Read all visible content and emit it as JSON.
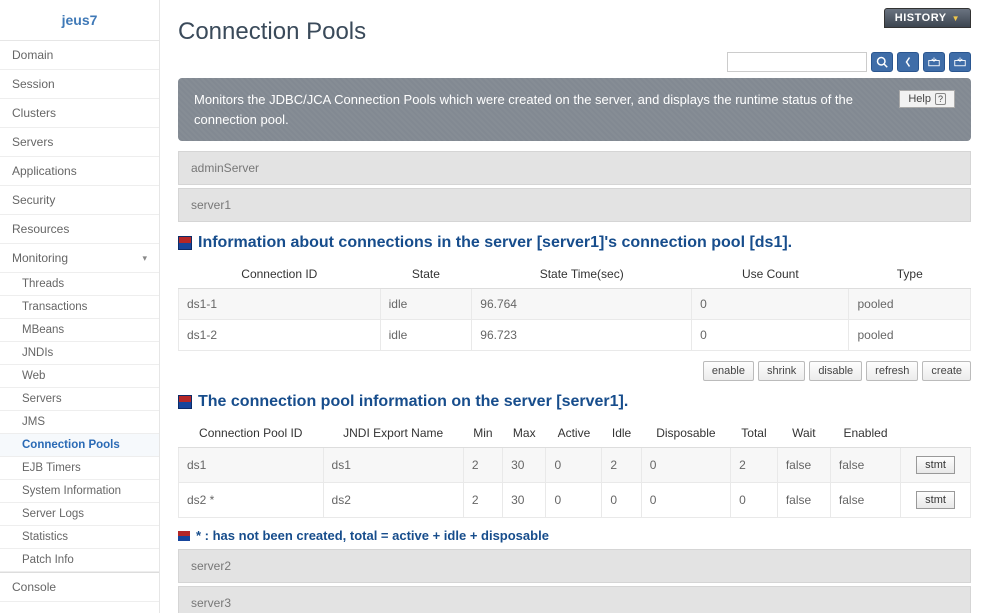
{
  "sidebar": {
    "title": "jeus7",
    "items": [
      {
        "label": "Domain"
      },
      {
        "label": "Session"
      },
      {
        "label": "Clusters"
      },
      {
        "label": "Servers"
      },
      {
        "label": "Applications"
      },
      {
        "label": "Security"
      },
      {
        "label": "Resources"
      },
      {
        "label": "Monitoring",
        "expandable": true
      }
    ],
    "sub": [
      {
        "label": "Threads"
      },
      {
        "label": "Transactions"
      },
      {
        "label": "MBeans"
      },
      {
        "label": "JNDIs"
      },
      {
        "label": "Web"
      },
      {
        "label": "Servers"
      },
      {
        "label": "JMS"
      },
      {
        "label": "Connection Pools",
        "active": true
      },
      {
        "label": "EJB Timers"
      },
      {
        "label": "System Information"
      },
      {
        "label": "Server Logs"
      },
      {
        "label": "Statistics"
      },
      {
        "label": "Patch Info"
      }
    ],
    "console": "Console"
  },
  "header": {
    "history": "HISTORY",
    "title": "Connection Pools",
    "search_placeholder": "",
    "desc": "Monitors the JDBC/JCA Connection Pools which were created on the server, and displays the runtime status of the connection pool.",
    "help": "Help"
  },
  "servers": {
    "admin": "adminServer",
    "s1": "server1",
    "s2": "server2",
    "s3": "server3"
  },
  "section1": {
    "title": "Information about connections in the server [server1]'s connection pool [ds1].",
    "cols": {
      "c1": "Connection ID",
      "c2": "State",
      "c3": "State Time(sec)",
      "c4": "Use Count",
      "c5": "Type"
    },
    "rows": [
      {
        "id": "ds1-1",
        "state": "idle",
        "time": "96.764",
        "use": "0",
        "type": "pooled"
      },
      {
        "id": "ds1-2",
        "state": "idle",
        "time": "96.723",
        "use": "0",
        "type": "pooled"
      }
    ]
  },
  "buttons": {
    "enable": "enable",
    "shrink": "shrink",
    "disable": "disable",
    "refresh": "refresh",
    "create": "create",
    "stmt": "stmt"
  },
  "section2": {
    "title": "The connection pool information on the server [server1].",
    "cols": {
      "c1": "Connection Pool ID",
      "c2": "JNDI Export Name",
      "c3": "Min",
      "c4": "Max",
      "c5": "Active",
      "c6": "Idle",
      "c7": "Disposable",
      "c8": "Total",
      "c9": "Wait",
      "c10": "Enabled"
    },
    "rows": [
      {
        "id": "ds1",
        "jndi": "ds1",
        "min": "2",
        "max": "30",
        "active": "0",
        "idle": "2",
        "disp": "0",
        "total": "2",
        "wait": "false",
        "en": "false"
      },
      {
        "id": "ds2 *",
        "jndi": "ds2",
        "min": "2",
        "max": "30",
        "active": "0",
        "idle": "0",
        "disp": "0",
        "total": "0",
        "wait": "false",
        "en": "false"
      }
    ]
  },
  "footnote": "* : has not been created, total = active + idle + disposable"
}
